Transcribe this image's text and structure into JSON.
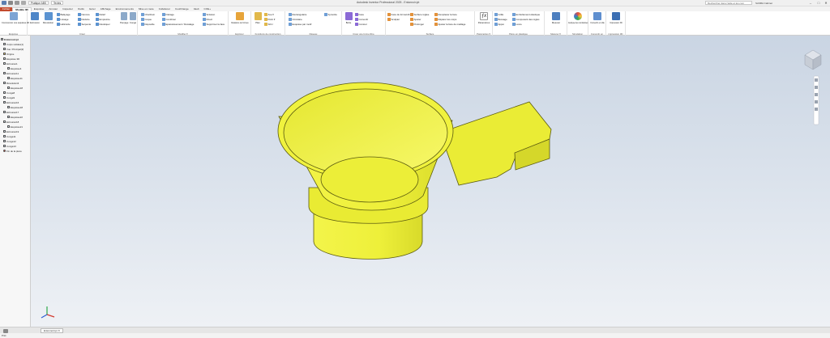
{
  "titlebar": {
    "quick_box_1": "Pratique ABS",
    "quick_box_2": "Textes",
    "app_title": "Autodesk Inventor Professional 2025 - Entonnoir.ipt",
    "search_placeholder": "Rechercher dans l'aide et les com",
    "user": "SASBA Cabinet",
    "minimize": "–",
    "maximize": "□",
    "close": "✕"
  },
  "tabs": [
    "Fichier",
    "Modèle 3D",
    "Esquisse",
    "Annoter",
    "Inspecter",
    "Outils",
    "Gérer",
    "Affichage",
    "Environnements",
    "Mise en route",
    "Collaborer",
    "CoolOrange",
    "Vault",
    "COE+"
  ],
  "ribbon": {
    "groups": {
      "esquisse": "Esquisse",
      "creer": "Créer",
      "modifier": "Modifier ▾",
      "explorer": "Explorer",
      "fonctions_construction": "Fonctions de construction",
      "reseau": "Réseau",
      "creer_forme_libre": "Créer une forme libre",
      "surface": "Surface",
      "parametres": "Paramètres ▾",
      "piece_plastique": "Pièce en plastique",
      "mesurer": "Mesurer ▾",
      "simulation": "Simulation",
      "convertir": "Convertir en",
      "imprimer": "impression 3D"
    },
    "buttons": {
      "sketch_big": "Commencer une esquisse 2D",
      "extrusion": "Extrusion",
      "revolution": "Révolution",
      "balayage": "Balayage",
      "lissage": "Lissage",
      "helicoide": "Hélicoïde",
      "nervure": "Nervure",
      "deduire": "Déduire",
      "serpente": "Serpente",
      "relief": "Relief",
      "empreinte": "Empreinte",
      "decalquer": "Décalquer",
      "percage": "Perçage",
      "conge": "Congé",
      "chanfrein": "Chanfrein",
      "coque": "Coque",
      "depouille": "Dépouille",
      "filetage": "Filetage",
      "combiner": "Combiner",
      "epaississement": "Epaississement / Décalage",
      "scission": "Scission",
      "direct": "Direct",
      "supprimer_face": "Supprimer la face",
      "relations_formes": "Relations de formes",
      "plan": "Plan",
      "axe": "Axe ▾",
      "point": "Point ▾",
      "scu": "SCU",
      "rectangulaire": "Rectangulaire",
      "circulaire": "Circulaire",
      "esquisse_motif": "Esquisse par motif",
      "symetrie": "Symétrie",
      "boite": "Boîte",
      "face": "Face",
      "convertir_fl": "Convertir",
      "contour": "Contour",
      "face_formeLibre": "Face de formeLibre",
      "sculpter": "Sculpter",
      "surface_reglee": "Surface réglée",
      "ajuster": "Ajuster",
      "prolonger": "Prolonger",
      "remplacer_face": "Remplacer la face",
      "reparer_corps": "Réparer les corps",
      "ajuster_maillage": "Ajuster la face de maillage",
      "parametres_big": "Paramètres",
      "grille": "Grille",
      "bossage": "Bossage",
      "appui": "Appui",
      "emboitement": "Emboîtement élastique",
      "composant_regles": "Composant des règles",
      "levre": "Lèvre",
      "mesurer_big": "Mesurer",
      "analyse_contraintes": "Analyse des contraintes",
      "convertir_tole": "Convertir en tôle",
      "impression_3d": "Impression 3D"
    }
  },
  "browser": {
    "items": [
      "Entonnoir.ipt",
      "Corps solides(1)",
      "Vue: Principal(2)",
      "Origine",
      "Esquisse 3D",
      "Extrusion1",
      "Esquisse4",
      "Extrusion11",
      "Esquisse11",
      "Révolution3",
      "Esquisse18",
      "Congé8",
      "Congé9",
      "Extrusion16",
      "Esquisse18",
      "Extrusion17",
      "Esquisse22",
      "Extrusion18",
      "Esquisse21",
      "Extrusion19",
      "Congé11",
      "Congé12",
      "Congé13",
      "Fin de la pièce"
    ]
  },
  "document_tab": "Entonnoir.ipt ✕",
  "status": "Prêt",
  "colors": {
    "part_yellow": "#eef03a",
    "part_edge": "#5a5a10",
    "file_tab": "#c24a2d"
  }
}
